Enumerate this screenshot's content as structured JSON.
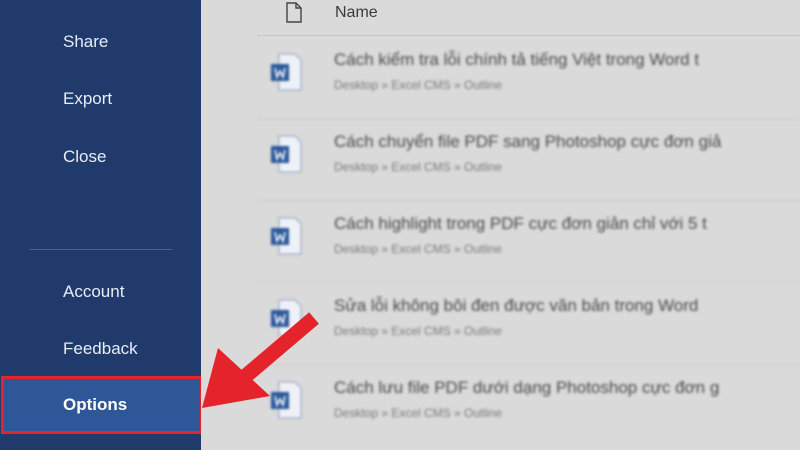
{
  "sidebar": {
    "items": [
      {
        "label": "Share"
      },
      {
        "label": "Export"
      },
      {
        "label": "Close"
      },
      {
        "label": "Account"
      },
      {
        "label": "Feedback"
      },
      {
        "label": "Options"
      }
    ]
  },
  "main": {
    "column_name": "Name",
    "files": [
      {
        "title": "Cách kiểm tra lỗi chính tả tiếng Việt trong Word t",
        "path": "Desktop » Excel CMS » Outline"
      },
      {
        "title": "Cách chuyển file PDF sang Photoshop cực đơn giả",
        "path": "Desktop » Excel CMS » Outline"
      },
      {
        "title": "Cách highlight trong PDF cực đơn giản chỉ với 5 t",
        "path": "Desktop » Excel CMS » Outline"
      },
      {
        "title": "Sửa lỗi không bôi đen được văn bản trong Word",
        "path": "Desktop » Excel CMS » Outline"
      },
      {
        "title": "Cách lưu file PDF dưới dạng Photoshop cực đơn g",
        "path": "Desktop » Excel CMS » Outline"
      }
    ]
  },
  "colors": {
    "sidebar_bg": "#1f3a6b",
    "selected_bg": "#2e5797",
    "highlight_red": "#e5232b",
    "word_blue": "#2b579a"
  },
  "icons": {
    "file_header": "file-icon",
    "doc": "word-doc-icon",
    "annotation": "red-arrow-icon"
  }
}
